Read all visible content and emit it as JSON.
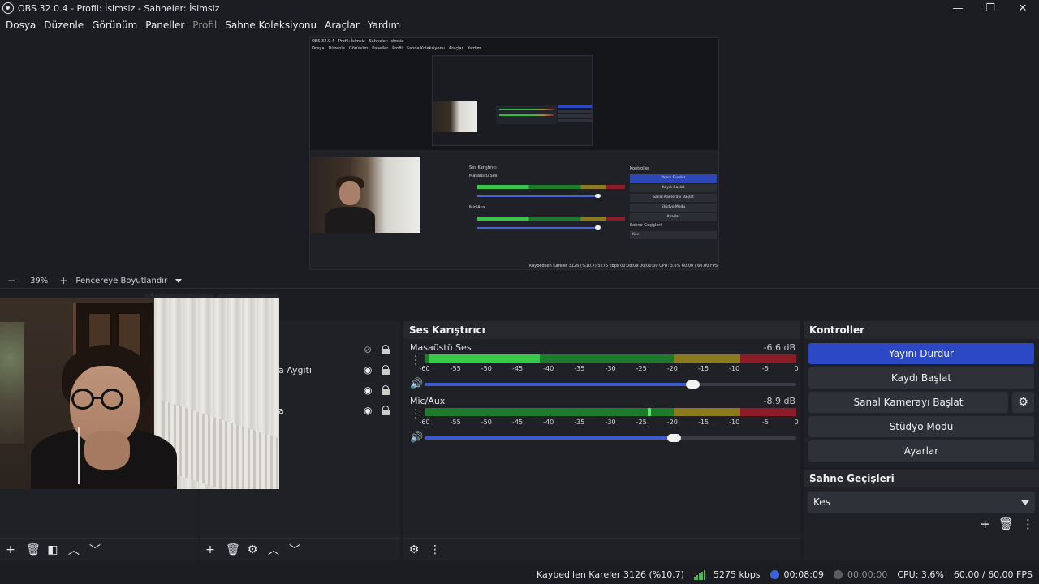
{
  "window": {
    "title": "OBS 32.0.4 - Profil: İsimsiz - Sahneler: İsimsiz",
    "minimize": "—",
    "maximize": "❐",
    "close": "✕"
  },
  "menu": [
    "Dosya",
    "Düzenle",
    "Görünüm",
    "Paneller",
    "Profil",
    "Sahne Koleksiyonu",
    "Araçlar",
    "Yardım"
  ],
  "menu_disabled": "Profil",
  "mini": {
    "title": "OBS 32.0.4 - Profil: İsimsiz - Sahneler: İsimsiz",
    "menu": [
      "Dosya",
      "Düzenle",
      "Görünüm",
      "Paneller",
      "Profil",
      "Sahne Koleksiyonu",
      "Araçlar",
      "Yardım"
    ],
    "mixer_title": "Ses Karıştırıcı",
    "ch1": "Masaüstü Ses",
    "ch2": "Mic/Aux",
    "ch1_db": "-6.6 dB",
    "ch2_db": "-8.9 dB",
    "controls_title": "Kontroller",
    "buttons": [
      "Yayını Durdur",
      "Kaydı Başlat",
      "Sanal Kamerayı Başlat",
      "Stüdyo Modu",
      "Ayarlar"
    ],
    "trans_title": "Sahne Geçişleri",
    "trans_value": "Kes",
    "status": "Kaybedilen Kareler 3126 (%10.7)   5275 kbps   00:08:09   00:00:00   CPU: 3.6%   60.00 / 60.00 FPS",
    "zoom_label": "Pencereye Boyutlandır"
  },
  "zoom": {
    "minus": "−",
    "value": "39%",
    "plus": "+",
    "mode": "Pencereye Boyutlandır"
  },
  "sources": {
    "items": [
      {
        "label": "",
        "eye": "hidden"
      },
      {
        "label": "na Aygıtı",
        "eye": "visible"
      },
      {
        "label": "",
        "eye": "visible"
      },
      {
        "label": "na",
        "eye": "visible"
      }
    ]
  },
  "mixer": {
    "title": "Ses Karıştırıcı",
    "channels": [
      {
        "name": "Masaüstü Ses",
        "db": "-6.6 dB",
        "volume_pct": 0.72
      },
      {
        "name": "Mic/Aux",
        "db": "-8.9 dB",
        "volume_pct": 0.67
      }
    ],
    "ticks": [
      "-60",
      "-55",
      "-50",
      "-45",
      "-40",
      "-35",
      "-30",
      "-25",
      "-20",
      "-15",
      "-10",
      "-5",
      "0"
    ]
  },
  "controls": {
    "title": "Kontroller",
    "stop_stream": "Yayını Durdur",
    "start_record": "Kaydı Başlat",
    "start_virtualcam": "Sanal Kamerayı Başlat",
    "studio_mode": "Stüdyo Modu",
    "settings": "Ayarlar"
  },
  "transitions": {
    "title": "Sahne Geçişleri",
    "selected": "Kes"
  },
  "status": {
    "dropped": "Kaybedilen Kareler 3126 (%10.7)",
    "bitrate": "5275 kbps",
    "stream_time": "00:08:09",
    "record_time": "00:00:00",
    "cpu": "CPU: 3.6%",
    "fps": "60.00 / 60.00 FPS"
  },
  "colors": {
    "accent": "#2c48c4",
    "meter_green": "#2bbf3c",
    "meter_yellow": "#8c7a1e",
    "meter_red": "#8c1c28",
    "stream_indicator": "#3a63d8"
  }
}
